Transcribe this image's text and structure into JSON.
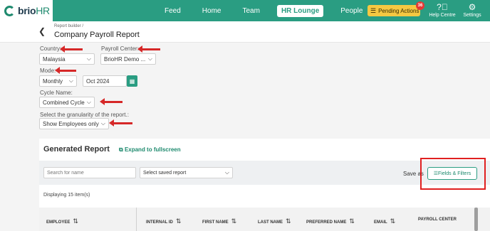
{
  "app": {
    "logo_main": "brio",
    "logo_accent": "HR"
  },
  "nav": {
    "feed": "Feed",
    "home": "Home",
    "team": "Team",
    "hr_lounge": "HR Lounge",
    "people": "People"
  },
  "pending": {
    "label": "Pending Actions",
    "count": "36"
  },
  "tools": {
    "help": "Help Centre",
    "settings": "Settings"
  },
  "page": {
    "breadcrumb": "Report builder /",
    "title": "Company Payroll Report"
  },
  "form": {
    "country_label": "Country:",
    "country_value": "Malaysia",
    "payroll_center_label": "Payroll Center:",
    "payroll_center_value": "BrioHR Demo ...",
    "mode_label": "Mode:",
    "mode_value": "Monthly",
    "period_value": "Oct 2024",
    "cycle_label": "Cycle Name:",
    "cycle_value": "Combined Cycle",
    "granularity_label": "Select the granularity of the report.:",
    "granularity_value": "Show Employees only"
  },
  "report": {
    "title": "Generated Report",
    "expand": "Expand to fullscreen",
    "search_placeholder": "Search for name",
    "saved_report": "Select saved report",
    "save_as": "Save as",
    "fields_filters": "Fields & Filters",
    "displaying": "Displaying 15 item(s)",
    "columns": [
      "EMPLOYEE",
      "INTERNAL ID",
      "FIRST NAME",
      "LAST NAME",
      "PREFERRED NAME",
      "EMAIL",
      "PAYROLL CENTER"
    ]
  },
  "colors": {
    "brand": "#2a9d82",
    "annotation": "#d62828",
    "pending": "#f5c842"
  }
}
